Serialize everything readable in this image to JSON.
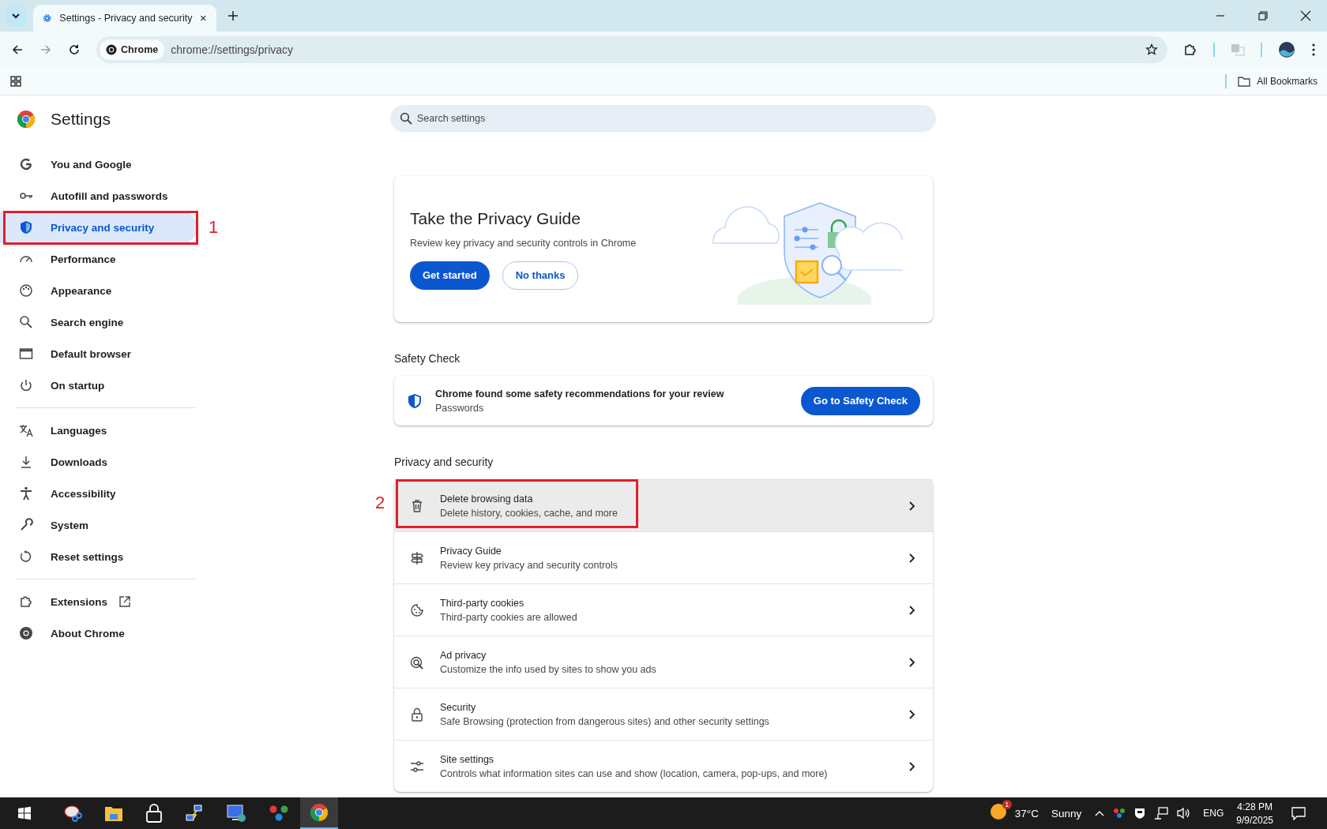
{
  "browser": {
    "tab": {
      "title": "Settings - Privacy and security",
      "selected": true
    },
    "chip": "Chrome",
    "url": "chrome://settings/privacy",
    "bookmarks": "All Bookmarks"
  },
  "sidebar": {
    "title": "Settings",
    "groups": [
      [
        {
          "label": "You and Google",
          "selected": false
        },
        {
          "label": "Autofill and passwords",
          "selected": false
        },
        {
          "label": "Privacy and security",
          "selected": true,
          "callout": "1"
        },
        {
          "label": "Performance",
          "selected": false
        },
        {
          "label": "Appearance",
          "selected": false
        },
        {
          "label": "Search engine",
          "selected": false
        },
        {
          "label": "Default browser",
          "selected": false
        },
        {
          "label": "On startup",
          "selected": false
        }
      ],
      [
        {
          "label": "Languages",
          "selected": false
        },
        {
          "label": "Downloads",
          "selected": false
        },
        {
          "label": "Accessibility",
          "selected": false
        },
        {
          "label": "System",
          "selected": false
        },
        {
          "label": "Reset settings",
          "selected": false
        }
      ],
      [
        {
          "label": "Extensions",
          "selected": false
        },
        {
          "label": "About Chrome",
          "selected": false
        }
      ]
    ]
  },
  "search": {
    "placeholder": "Search settings"
  },
  "promo": {
    "title": "Take the Privacy Guide",
    "description": "Review key privacy and security controls in Chrome",
    "buttons": [
      "Get started",
      "No thanks"
    ]
  },
  "safety_check": {
    "heading": "Safety Check",
    "title": "Chrome found some safety recommendations for your review",
    "subtitle": "Passwords",
    "button": "Go to Safety Check"
  },
  "privacy": {
    "heading": "Privacy and security",
    "rows": [
      {
        "title": "Delete browsing data",
        "subtitle": "Delete history, cookies, cache, and more",
        "highlighted": true,
        "callout": "2"
      },
      {
        "title": "Privacy Guide",
        "subtitle": "Review key privacy and security controls",
        "highlighted": false
      },
      {
        "title": "Third-party cookies",
        "subtitle": "Third-party cookies are allowed",
        "highlighted": false
      },
      {
        "title": "Ad privacy",
        "subtitle": "Customize the info used by sites to show you ads",
        "highlighted": false
      },
      {
        "title": "Security",
        "subtitle": "Safe Browsing (protection from dangerous sites) and other security settings",
        "highlighted": false
      },
      {
        "title": "Site settings",
        "subtitle": "Controls what information sites can use and show (location, camera, pop-ups, and more)",
        "highlighted": false
      }
    ]
  },
  "taskbar": {
    "weather_badge": "1",
    "temperature": "37°C",
    "condition": "Sunny",
    "language": "ENG",
    "time": "4:28 PM",
    "date": "9/9/2025"
  }
}
